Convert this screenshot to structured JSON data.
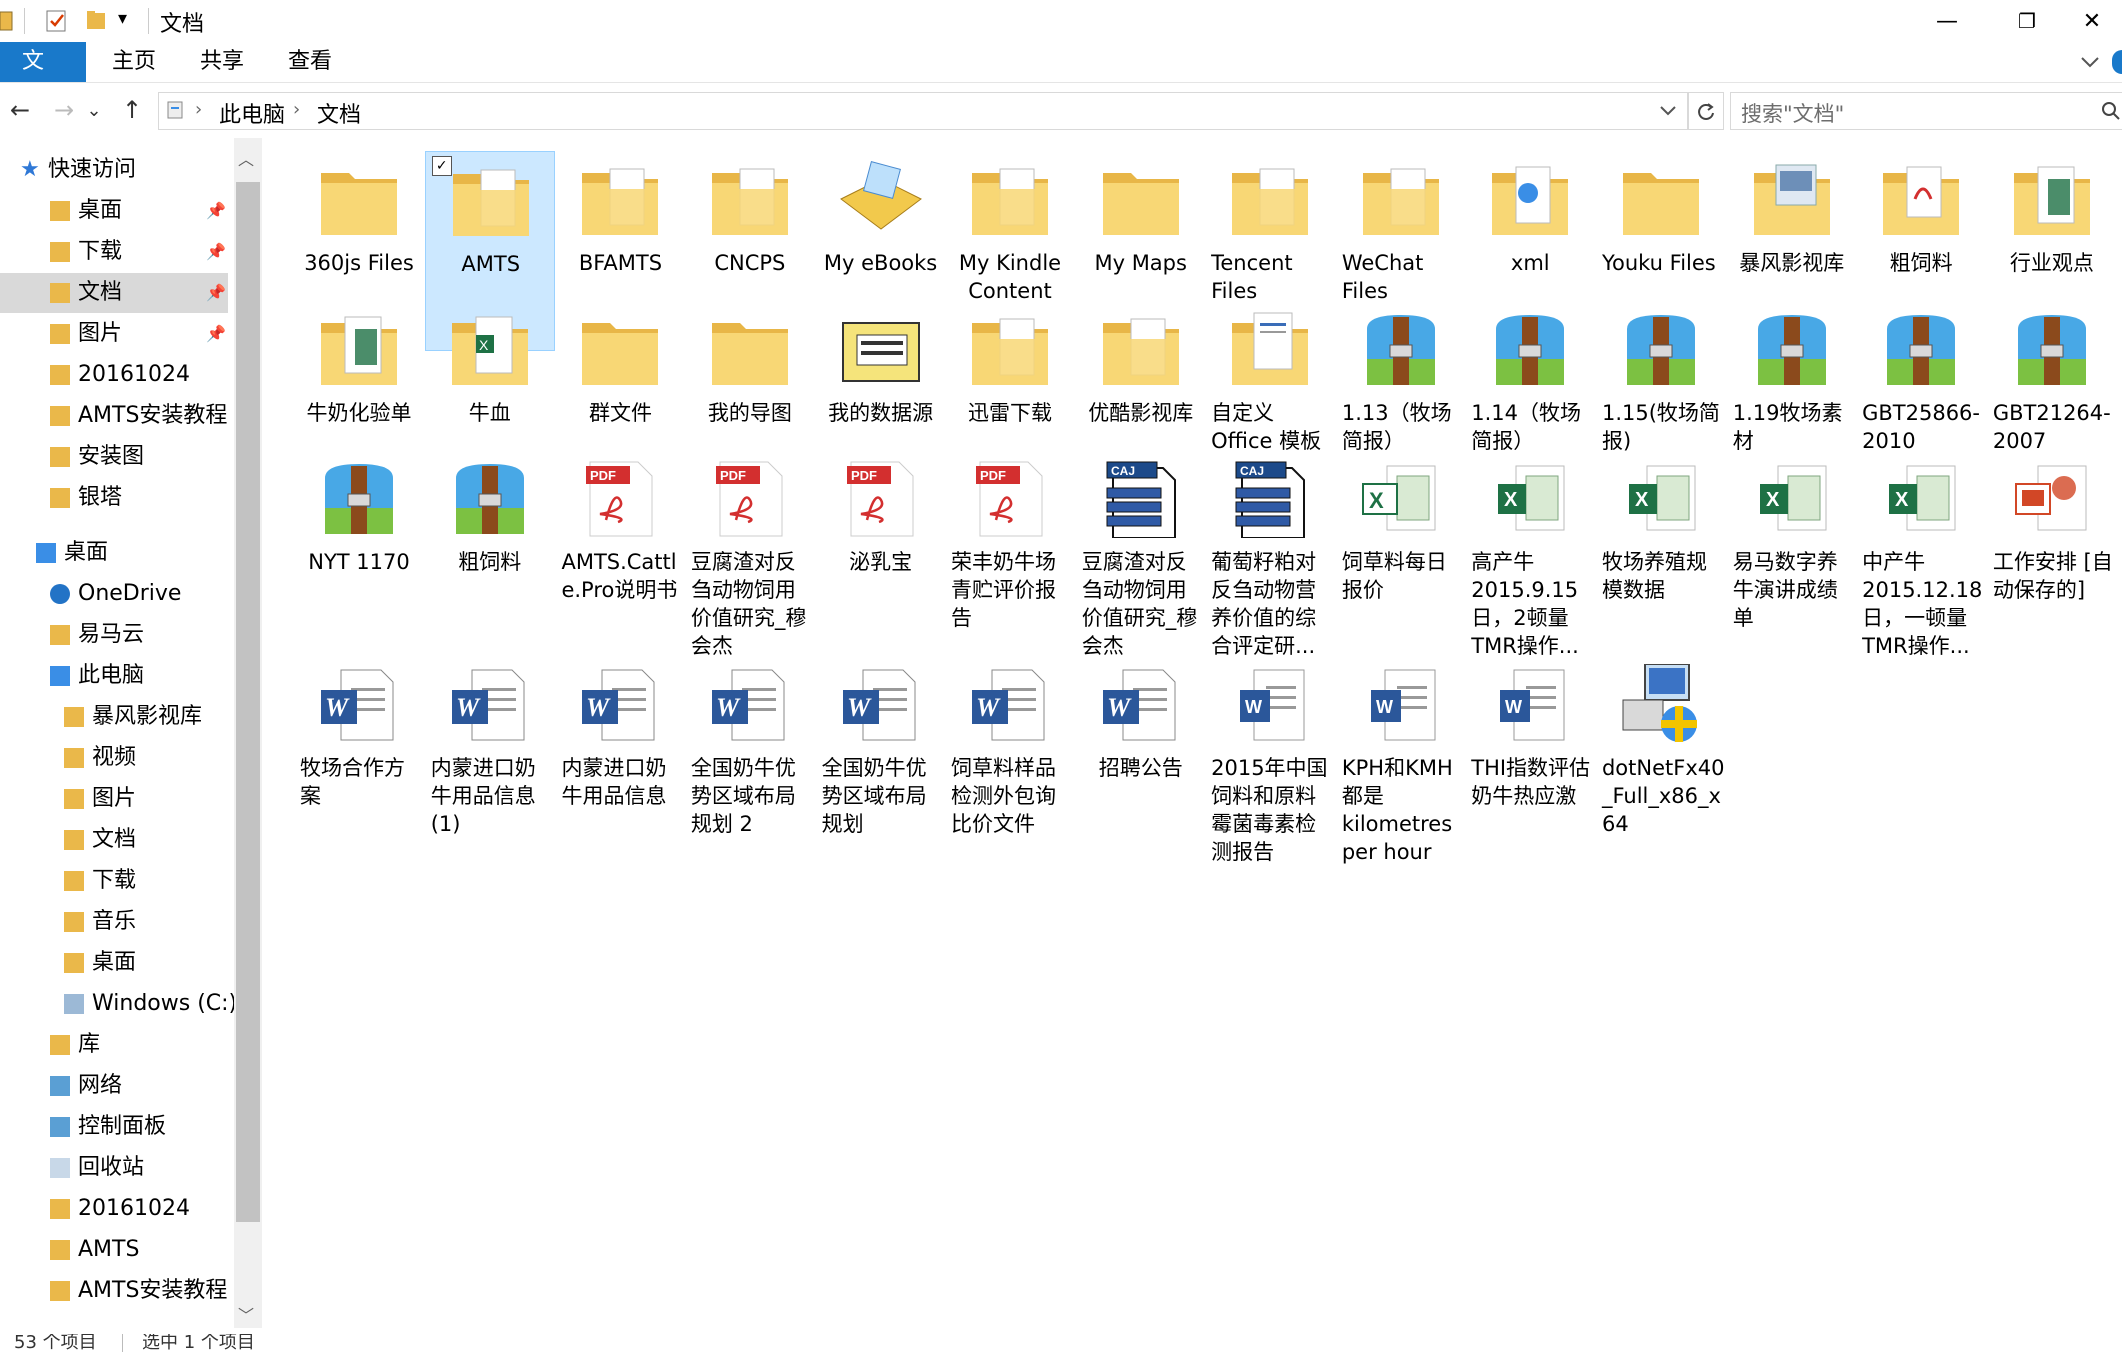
{
  "window": {
    "title": "文档",
    "minimize_icon": "—",
    "maximize_icon": "❐",
    "close_icon": "✕"
  },
  "ribbon": {
    "tabs": [
      "文件",
      "主页",
      "共享",
      "查看"
    ],
    "expand_icon": "chevron-down-icon"
  },
  "nav": {
    "back": "←",
    "forward": "→",
    "recent": "⌄",
    "up": "↑",
    "breadcrumb": [
      "此电脑",
      "文档"
    ],
    "separator": "›",
    "search_placeholder": "搜索\"文档\""
  },
  "navpane": {
    "items": [
      {
        "label": "快速访问",
        "icon": "star-icon",
        "indent": 48,
        "pinned": false
      },
      {
        "label": "桌面",
        "icon": "desktop-folder-icon",
        "indent": 78,
        "pinned": true
      },
      {
        "label": "下载",
        "icon": "download-folder-icon",
        "indent": 78,
        "pinned": true
      },
      {
        "label": "文档",
        "icon": "documents-folder-icon",
        "indent": 78,
        "pinned": true,
        "selected": true
      },
      {
        "label": "图片",
        "icon": "pictures-folder-icon",
        "indent": 78,
        "pinned": true
      },
      {
        "label": "20161024",
        "icon": "folder-icon",
        "indent": 78,
        "pinned": false
      },
      {
        "label": "AMTS安装教程",
        "icon": "folder-icon",
        "indent": 78,
        "pinned": false
      },
      {
        "label": "安装图",
        "icon": "folder-icon",
        "indent": 78,
        "pinned": false
      },
      {
        "label": "银塔",
        "icon": "folder-icon",
        "indent": 78,
        "pinned": false
      },
      {
        "label": "桌面",
        "icon": "desktop-icon",
        "indent": 64,
        "pinned": false
      },
      {
        "label": "OneDrive",
        "icon": "onedrive-icon",
        "indent": 78,
        "pinned": false
      },
      {
        "label": "易马云",
        "icon": "user-folder-icon",
        "indent": 78,
        "pinned": false
      },
      {
        "label": "此电脑",
        "icon": "this-pc-icon",
        "indent": 78,
        "pinned": false
      },
      {
        "label": "暴风影视库",
        "icon": "media-library-icon",
        "indent": 92,
        "pinned": false
      },
      {
        "label": "视频",
        "icon": "videos-folder-icon",
        "indent": 92,
        "pinned": false
      },
      {
        "label": "图片",
        "icon": "pictures-folder-icon",
        "indent": 92,
        "pinned": false
      },
      {
        "label": "文档",
        "icon": "documents-folder-icon",
        "indent": 92,
        "pinned": false
      },
      {
        "label": "下载",
        "icon": "download-folder-icon",
        "indent": 92,
        "pinned": false
      },
      {
        "label": "音乐",
        "icon": "music-folder-icon",
        "indent": 92,
        "pinned": false
      },
      {
        "label": "桌面",
        "icon": "desktop-folder-icon",
        "indent": 92,
        "pinned": false
      },
      {
        "label": "Windows (C:)",
        "icon": "drive-icon",
        "indent": 92,
        "pinned": false
      },
      {
        "label": "库",
        "icon": "libraries-icon",
        "indent": 78,
        "pinned": false
      },
      {
        "label": "网络",
        "icon": "network-icon",
        "indent": 78,
        "pinned": false
      },
      {
        "label": "控制面板",
        "icon": "control-panel-icon",
        "indent": 78,
        "pinned": false
      },
      {
        "label": "回收站",
        "icon": "recycle-bin-icon",
        "indent": 78,
        "pinned": false
      },
      {
        "label": "20161024",
        "icon": "folder-icon",
        "indent": 78,
        "pinned": false
      },
      {
        "label": "AMTS",
        "icon": "folder-icon",
        "indent": 78,
        "pinned": false
      },
      {
        "label": "AMTS安装教程",
        "icon": "folder-icon",
        "indent": 78,
        "pinned": false
      }
    ],
    "pin_icon": "📌"
  },
  "files": [
    {
      "name": "360js Files",
      "type": "folder"
    },
    {
      "name": "AMTS",
      "type": "folder-docs",
      "selected": true
    },
    {
      "name": "BFAMTS",
      "type": "folder-docs"
    },
    {
      "name": "CNCPS",
      "type": "folder-docs"
    },
    {
      "name": "My eBooks",
      "type": "ebooks"
    },
    {
      "name": "My Kindle Content",
      "type": "folder-docs"
    },
    {
      "name": "My Maps",
      "type": "folder"
    },
    {
      "name": "Tencent Files",
      "type": "folder-docs",
      "left": true
    },
    {
      "name": "WeChat Files",
      "type": "folder-docs",
      "left": true
    },
    {
      "name": "xml",
      "type": "folder-web"
    },
    {
      "name": "Youku Files",
      "type": "folder",
      "left": true
    },
    {
      "name": "暴风影视库",
      "type": "folder-media"
    },
    {
      "name": "粗饲料",
      "type": "folder-pdf"
    },
    {
      "name": "行业观点",
      "type": "folder-excel"
    },
    {
      "name": "牛奶化验单",
      "type": "folder-excel"
    },
    {
      "name": "牛血",
      "type": "folder-excel2"
    },
    {
      "name": "群文件",
      "type": "folder"
    },
    {
      "name": "我的导图",
      "type": "folder"
    },
    {
      "name": "我的数据源",
      "type": "datasource"
    },
    {
      "name": "迅雷下载",
      "type": "folder-docs"
    },
    {
      "name": "优酷影视库",
      "type": "folder-docs"
    },
    {
      "name": "自定义 Office 模板",
      "type": "folder-office",
      "left": true
    },
    {
      "name": "1.13（牧场简报）",
      "type": "archive",
      "left": true
    },
    {
      "name": "1.14（牧场简报）",
      "type": "archive",
      "left": true
    },
    {
      "name": "1.15(牧场简报)",
      "type": "archive",
      "left": true
    },
    {
      "name": "1.19牧场素材",
      "type": "archive",
      "left": true
    },
    {
      "name": "GBT25866-2010",
      "type": "archive",
      "left": true
    },
    {
      "name": "GBT21264-2007",
      "type": "archive",
      "left": true
    },
    {
      "name": "NYT 1170",
      "type": "archive"
    },
    {
      "name": "粗饲料",
      "type": "archive"
    },
    {
      "name": "AMTS.Cattle.Pro说明书",
      "type": "pdf",
      "left": true
    },
    {
      "name": "豆腐渣对反刍动物饲用价值研究_穆会杰",
      "type": "pdf",
      "left": true
    },
    {
      "name": "泌乳宝",
      "type": "pdf"
    },
    {
      "name": "荣丰奶牛场青贮评价报告",
      "type": "pdf",
      "left": true
    },
    {
      "name": "豆腐渣对反刍动物饲用价值研究_穆会杰",
      "type": "caj",
      "left": true
    },
    {
      "name": "葡萄籽粕对反刍动物营养价值的综合评定研...",
      "type": "caj",
      "left": true
    },
    {
      "name": "饲草料每日报价",
      "type": "excel-old",
      "left": true
    },
    {
      "name": "高产牛2015.9.15日，2顿量TMR操作...",
      "type": "excel",
      "left": true
    },
    {
      "name": "牧场养殖规模数据",
      "type": "excel",
      "left": true
    },
    {
      "name": "易马数字养牛演讲成绩单",
      "type": "excel",
      "left": true
    },
    {
      "name": "中产牛2015.12.18日，一顿量TMR操作...",
      "type": "excel",
      "left": true
    },
    {
      "name": "工作安排 [自动保存的]",
      "type": "ppt",
      "left": true
    },
    {
      "name": "牧场合作方案",
      "type": "word-old",
      "left": true
    },
    {
      "name": "内蒙进口奶牛用品信息(1)",
      "type": "word-old",
      "left": true
    },
    {
      "name": "内蒙进口奶牛用品信息",
      "type": "word-old",
      "left": true
    },
    {
      "name": "全国奶牛优势区域布局规划 2",
      "type": "word-old",
      "left": true
    },
    {
      "name": "全国奶牛优势区域布局规划",
      "type": "word-old",
      "left": true
    },
    {
      "name": "饲草料样品检测外包询比价文件",
      "type": "word-old",
      "left": true
    },
    {
      "name": "招聘公告",
      "type": "word-old"
    },
    {
      "name": "2015年中国饲料和原料霉菌毒素检测报告",
      "type": "word",
      "left": true
    },
    {
      "name": "KPH和KMH都是kilometres per hour",
      "type": "word",
      "left": true
    },
    {
      "name": "THI指数评估奶牛热应激",
      "type": "word",
      "left": true
    },
    {
      "name": "dotNetFx40_Full_x86_x64",
      "type": "installer",
      "left": true
    }
  ],
  "status": {
    "count": "53 个项目",
    "selected": "选中 1 个项目"
  },
  "colors": {
    "accent": "#1979ca",
    "selection": "#cce8ff",
    "folder": "#f8d775"
  }
}
